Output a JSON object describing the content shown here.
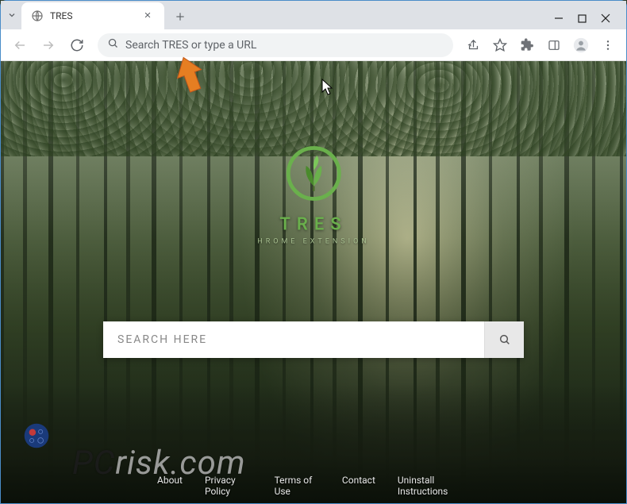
{
  "tab": {
    "title": "TRES"
  },
  "omnibox": {
    "placeholder": "Search TRES or type a URL"
  },
  "brand": {
    "name": "TRES",
    "subtitle": "HROME EXTENSION"
  },
  "search": {
    "placeholder": "SEARCH HERE"
  },
  "footer": {
    "links": [
      "About",
      "Privacy Policy",
      "Terms of Use",
      "Contact",
      "Uninstall Instructions"
    ]
  },
  "watermark": {
    "left": "PC",
    "right": "risk.com"
  },
  "colors": {
    "accent_green": "#6ab04c",
    "arrow": "#e67e22"
  }
}
